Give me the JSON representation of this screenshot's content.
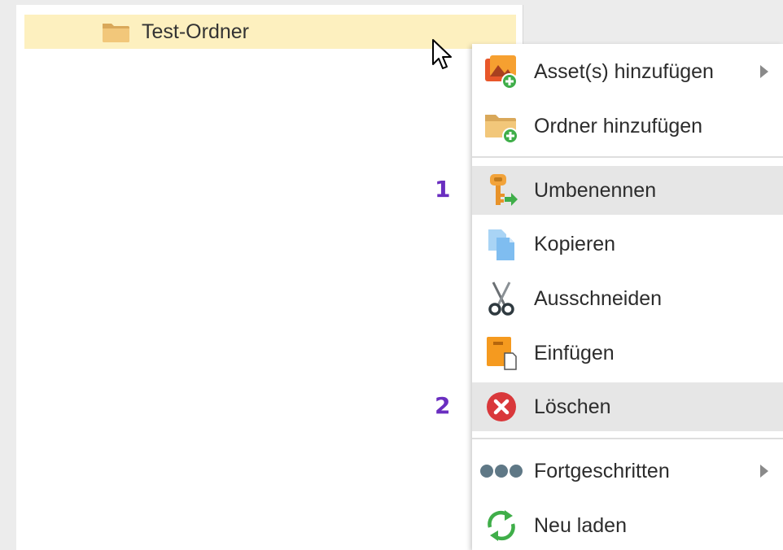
{
  "tree": {
    "selected_folder": "Test-Ordner"
  },
  "context_menu": {
    "items": [
      {
        "label": "Asset(s) hinzufügen",
        "icon": "add-asset-icon",
        "submenu": true
      },
      {
        "label": "Ordner hinzufügen",
        "icon": "add-folder-icon",
        "submenu": false
      },
      {
        "label": "Umbenennen",
        "icon": "rename-key-icon",
        "submenu": false,
        "highlighted": true
      },
      {
        "label": "Kopieren",
        "icon": "copy-icon",
        "submenu": false
      },
      {
        "label": "Ausschneiden",
        "icon": "scissors-icon",
        "submenu": false
      },
      {
        "label": "Einfügen",
        "icon": "paste-icon",
        "submenu": false
      },
      {
        "label": "Löschen",
        "icon": "delete-icon",
        "submenu": false,
        "highlighted": true
      },
      {
        "label": "Fortgeschritten",
        "icon": "more-dots-icon",
        "submenu": true
      },
      {
        "label": "Neu laden",
        "icon": "reload-icon",
        "submenu": false
      }
    ]
  },
  "callouts": [
    "1",
    "2"
  ],
  "colors": {
    "selection": "#fdf0bf",
    "highlight": "#e6e6e6",
    "callout": "#6a2ec0",
    "folder": "#e0b060",
    "delete": "#d9383b",
    "reload": "#3fae49"
  }
}
